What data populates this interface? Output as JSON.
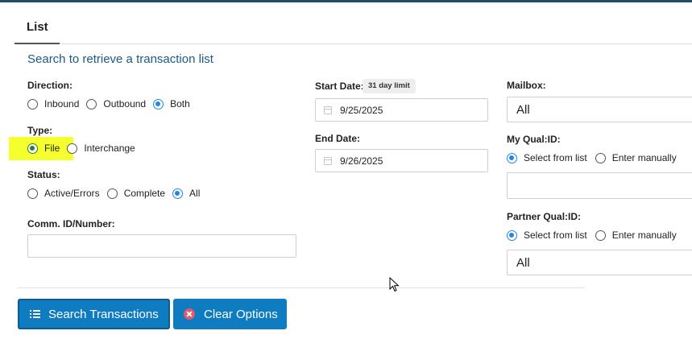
{
  "tabs": [
    {
      "label": "List",
      "active": true
    }
  ],
  "heading": "Search to retrieve a transaction list",
  "direction": {
    "label": "Direction:",
    "options": [
      "Inbound",
      "Outbound",
      "Both"
    ],
    "selected": "Both"
  },
  "type": {
    "label": "Type:",
    "options": [
      "File",
      "Interchange"
    ],
    "selected": "File"
  },
  "status": {
    "label": "Status:",
    "options": [
      "Active/Errors",
      "Complete",
      "All"
    ],
    "selected": "All"
  },
  "comm_id": {
    "label": "Comm. ID/Number:",
    "value": ""
  },
  "start_date": {
    "label": "Start Date:",
    "badge": "31 day limit",
    "value": "9/25/2025"
  },
  "end_date": {
    "label": "End Date:",
    "value": "9/26/2025"
  },
  "mailbox": {
    "label": "Mailbox:",
    "value": "All"
  },
  "my_qual": {
    "label": "My Qual:ID:",
    "options": [
      "Select from list",
      "Enter manually"
    ],
    "selected": "Select from list",
    "value": ""
  },
  "partner_qual": {
    "label": "Partner Qual:ID:",
    "options": [
      "Select from list",
      "Enter manually"
    ],
    "selected": "Select from list",
    "value": "All"
  },
  "buttons": {
    "search": "Search Transactions",
    "clear": "Clear Options"
  },
  "colors": {
    "accent": "#0f7cc1",
    "heading": "#1a5b84",
    "radio_selected": "#1e88e5",
    "highlight": "#f4ff2d",
    "clear_icon": "#e05a6a"
  },
  "icons": {
    "search_button": "list-icon",
    "clear_button": "close-circle-icon",
    "date_fields": "calendar-icon"
  }
}
